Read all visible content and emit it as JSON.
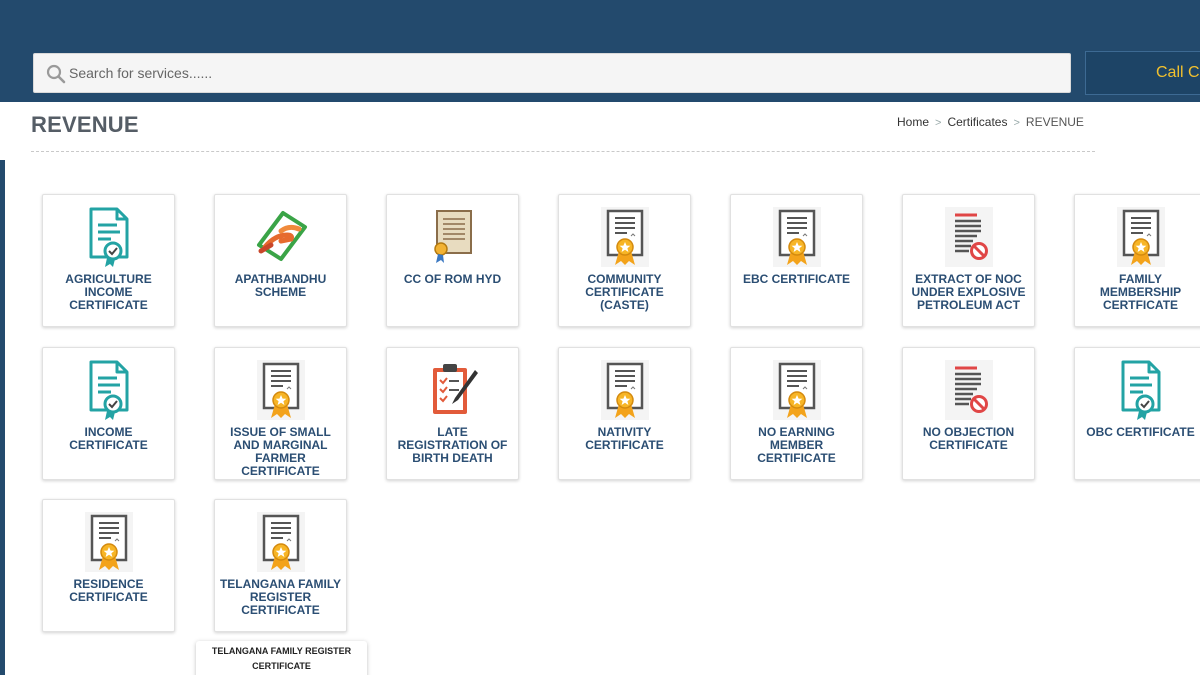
{
  "search": {
    "placeholder": "Search for services......"
  },
  "call_button": {
    "label": "Call Center"
  },
  "page": {
    "title": "REVENUE"
  },
  "breadcrumb": {
    "items": [
      "Home",
      "Certificates",
      "REVENUE"
    ]
  },
  "colors": {
    "header_bg": "#234a6d",
    "call_text": "#f2c12e",
    "label_text": "#2b4e73",
    "title_text": "#555d66"
  },
  "services": [
    {
      "label": "AGRICULTURE INCOME CERTIFICATE",
      "icon": "income-document-icon"
    },
    {
      "label": "APATHBANDHU SCHEME",
      "icon": "helping-hands-icon"
    },
    {
      "label": "CC OF ROM HYD",
      "icon": "scroll-certificate-icon"
    },
    {
      "label": "COMMUNITY CERTIFICATE (CASTE)",
      "icon": "certificate-ribbon-icon"
    },
    {
      "label": "EBC CERTIFICATE",
      "icon": "certificate-ribbon-icon"
    },
    {
      "label": "EXTRACT OF NOC UNDER EXPLOSIVE PETROLEUM ACT",
      "icon": "no-objection-document-icon"
    },
    {
      "label": "FAMILY MEMBERSHIP CERTFICATE",
      "icon": "certificate-ribbon-icon"
    },
    {
      "label": "INCOME CERTIFICATE",
      "icon": "income-document-icon"
    },
    {
      "label": "ISSUE OF SMALL AND MARGINAL FARMER CERTIFICATE",
      "icon": "certificate-ribbon-icon"
    },
    {
      "label": "LATE REGISTRATION OF BIRTH DEATH",
      "icon": "clipboard-checklist-icon"
    },
    {
      "label": "NATIVITY CERTIFICATE",
      "icon": "certificate-ribbon-icon"
    },
    {
      "label": "NO EARNING MEMBER CERTIFICATE",
      "icon": "certificate-ribbon-icon"
    },
    {
      "label": "NO OBJECTION CERTIFICATE",
      "icon": "no-objection-document-icon"
    },
    {
      "label": "OBC CERTIFICATE",
      "icon": "income-document-icon"
    },
    {
      "label": "RESIDENCE CERTIFICATE",
      "icon": "certificate-ribbon-icon"
    },
    {
      "label": "TELANGANA FAMILY REGISTER CERTIFICATE",
      "icon": "certificate-ribbon-icon"
    }
  ],
  "tooltip": {
    "text": "TELANGANA FAMILY REGISTER CERTIFICATE"
  }
}
